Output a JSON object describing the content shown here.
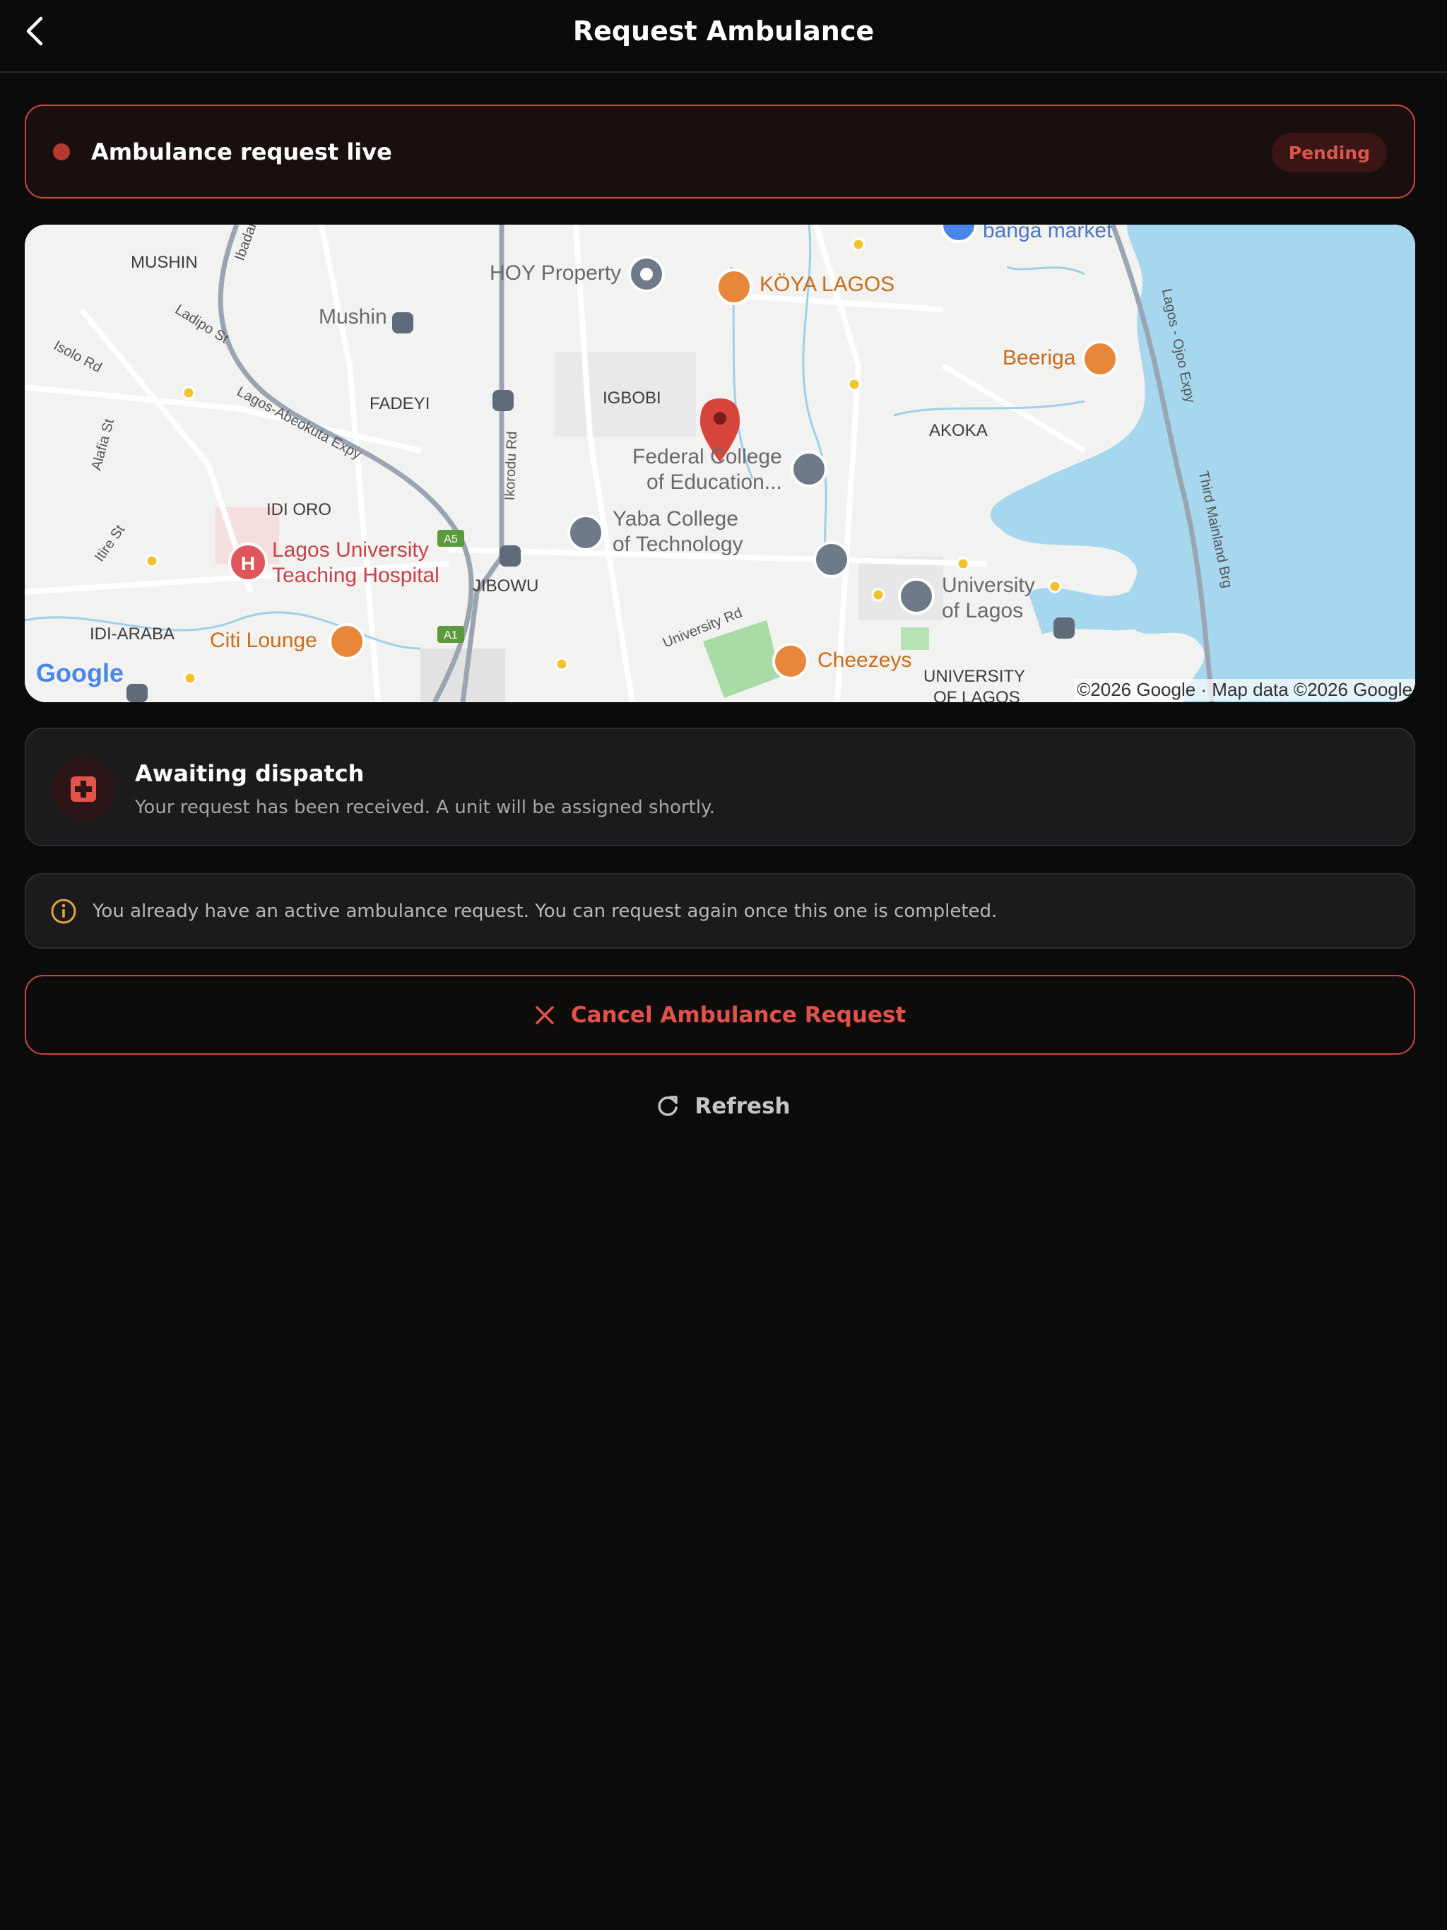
{
  "header": {
    "title": "Request Ambulance",
    "back_icon": "chevron-left-icon"
  },
  "live_banner": {
    "text": "Ambulance request live",
    "status": "Pending",
    "accent_color": "#c8473f"
  },
  "map": {
    "areas": [
      "MUSHIN",
      "FADEYI",
      "IGBOBI",
      "AKOKA",
      "IDI ORO",
      "JIBOWU",
      "IDI-ARABA",
      "UNIVERSITY",
      "OF LAGOS"
    ],
    "roads": [
      "Ladipo St",
      "Isolo Rd",
      "Lagos-Abeokuta Expy",
      "Alafia St",
      "Itire St",
      "Ikorodu Rd",
      "University Rd",
      "Lagos - Ojoo Expy",
      "Third Mainland Brg",
      "Ibadan"
    ],
    "route_shields": [
      "A5",
      "A1"
    ],
    "pois": {
      "hoy": "HOY Property",
      "koya": "KÖYA LAGOS",
      "mushin_station": "Mushin",
      "beeriga": "Beeriga",
      "fce_line1": "Federal College",
      "fce_line2": "of Education...",
      "yaba_line1": "Yaba College",
      "yaba_line2": "of Technology",
      "luth_line1": "Lagos University",
      "luth_line2": "Teaching Hospital",
      "unilag_line1": "University",
      "unilag_line2": "of Lagos",
      "citi": "Citi Lounge",
      "cheezeys": "Cheezeys",
      "banga": "banga market"
    },
    "logo": "Google",
    "copyright": "©2026 Google · Map data ©2026 Google"
  },
  "dispatch": {
    "title": "Awaiting dispatch",
    "subtitle": "Your request has been received. A unit will be assigned shortly.",
    "icon": "medical-cross-icon"
  },
  "notice": {
    "text": "You already have an active ambulance request. You can request again once this one is completed.",
    "icon": "info-icon"
  },
  "actions": {
    "cancel_label": "Cancel Ambulance Request",
    "refresh_label": "Refresh"
  }
}
